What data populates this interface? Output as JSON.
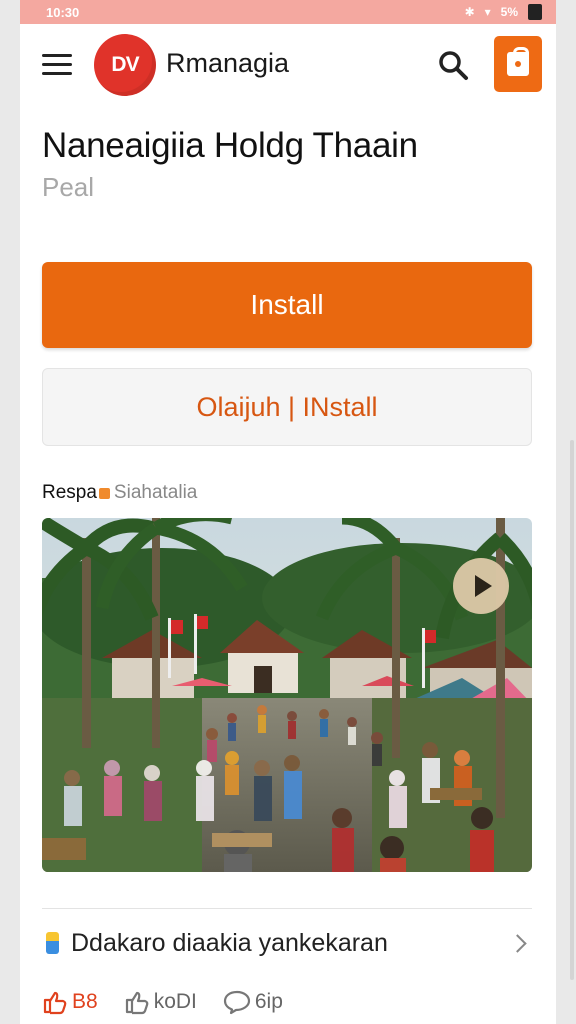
{
  "status_bar": {
    "time": "10:30",
    "battery_label": "5%"
  },
  "header": {
    "logo_text": "DV",
    "brand_name": "Rmanagia"
  },
  "app": {
    "title": "Naneaigiia Holdg Thaain",
    "subtitle": "Peal"
  },
  "buttons": {
    "install_label": "Install",
    "secondary_label": "Olaijuh | INstall"
  },
  "media_section": {
    "label_strong": "Respa",
    "label_muted": "Siahatalia"
  },
  "list_row": {
    "text": "Ddakaro diaakia yankekaran"
  },
  "actions": {
    "like_count": "B8",
    "share_label": "koDI",
    "comment_label": "6ip"
  },
  "colors": {
    "accent": "#e9680f",
    "status_bar": "#f4a8a0",
    "logo": "#e0332a"
  }
}
